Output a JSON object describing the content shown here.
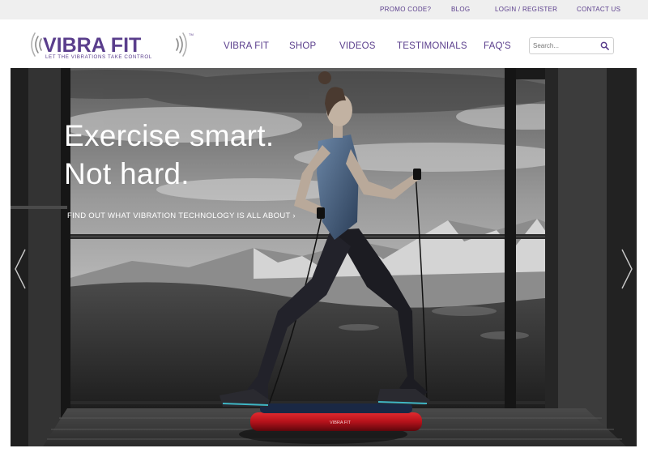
{
  "topbar": {
    "promo": "PROMO CODE?",
    "blog": "BLOG",
    "login": "LOGIN / REGISTER",
    "contact": "CONTACT US"
  },
  "logo": {
    "brand": "VIBRA FIT",
    "trademark": "TM",
    "tagline": "LET THE VIBRATIONS TAKE CONTROL"
  },
  "nav": {
    "items": [
      "VIBRA FIT",
      "SHOP",
      "VIDEOS",
      "TESTIMONIALS",
      "FAQ'S"
    ]
  },
  "search": {
    "placeholder": "Search..."
  },
  "hero": {
    "headline_line1": "Exercise smart.",
    "headline_line2": "Not hard.",
    "cta": "FIND OUT WHAT VIBRATION TECHNOLOGY IS ALL ABOUT ›",
    "platform_label": "VIBRA FIT"
  },
  "colors": {
    "brand_purple": "#5a3e8c",
    "platform_red": "#b5121b",
    "topbar_bg": "#efefef"
  }
}
